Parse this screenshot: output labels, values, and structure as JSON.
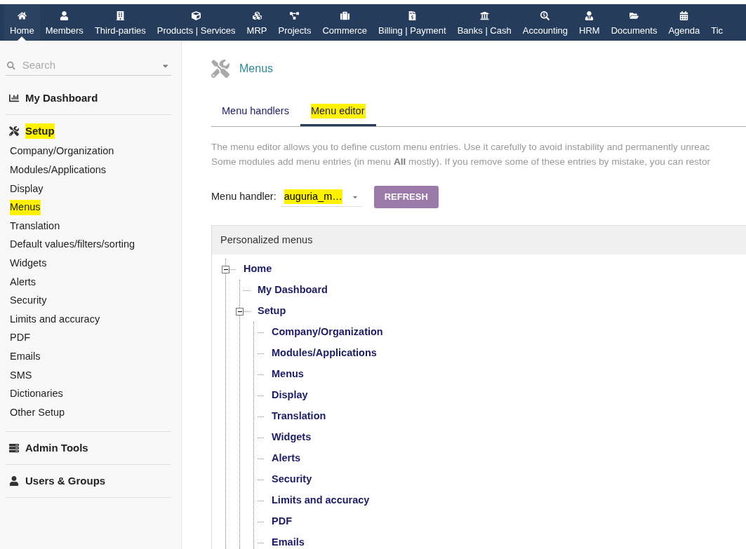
{
  "top_nav": [
    {
      "label": "Home",
      "selected": true
    },
    {
      "label": "Members",
      "selected": false
    },
    {
      "label": "Third-parties",
      "selected": false
    },
    {
      "label": "Products | Services",
      "selected": false
    },
    {
      "label": "MRP",
      "selected": false
    },
    {
      "label": "Projects",
      "selected": false
    },
    {
      "label": "Commerce",
      "selected": false
    },
    {
      "label": "Billing | Payment",
      "selected": false
    },
    {
      "label": "Banks | Cash",
      "selected": false
    },
    {
      "label": "Accounting",
      "selected": false
    },
    {
      "label": "HRM",
      "selected": false
    },
    {
      "label": "Documents",
      "selected": false
    },
    {
      "label": "Agenda",
      "selected": false
    },
    {
      "label": "Tic",
      "selected": false
    }
  ],
  "sidebar": {
    "search": {
      "placeholder": "Search"
    },
    "sections": [
      {
        "kind": "dashboard",
        "title": "My Dashboard",
        "highlighted": false
      },
      {
        "kind": "setup",
        "title": "Setup",
        "highlighted": true,
        "items": [
          {
            "label": "Company/Organization",
            "highlighted": false
          },
          {
            "label": "Modules/Applications",
            "highlighted": false
          },
          {
            "label": "Display",
            "highlighted": false
          },
          {
            "label": "Menus",
            "highlighted": true
          },
          {
            "label": "Translation",
            "highlighted": false
          },
          {
            "label": "Default values/filters/sorting",
            "highlighted": false
          },
          {
            "label": "Widgets",
            "highlighted": false
          },
          {
            "label": "Alerts",
            "highlighted": false
          },
          {
            "label": "Security",
            "highlighted": false
          },
          {
            "label": "Limits and accuracy",
            "highlighted": false
          },
          {
            "label": "PDF",
            "highlighted": false
          },
          {
            "label": "Emails",
            "highlighted": false
          },
          {
            "label": "SMS",
            "highlighted": false
          },
          {
            "label": "Dictionaries",
            "highlighted": false
          },
          {
            "label": "Other Setup",
            "highlighted": false
          }
        ]
      },
      {
        "kind": "admin",
        "title": "Admin Tools",
        "highlighted": false
      },
      {
        "kind": "users",
        "title": "Users & Groups",
        "highlighted": false
      }
    ]
  },
  "page": {
    "title": "Menus",
    "tabs": [
      {
        "label": "Menu handlers",
        "selected": false,
        "highlighted": false
      },
      {
        "label": "Menu editor",
        "selected": true,
        "highlighted": true
      }
    ],
    "description": [
      "The menu editor allows you to define custom menu entries. Use it carefully to avoid instability and permanently unreac",
      "Some modules add menu entries (in menu **All** mostly). If you remove some of these entries by mistake, you can restor"
    ],
    "handler": {
      "label": "Menu handler:",
      "value": "auguria_m…",
      "highlighted": true
    },
    "refresh_button": "REFRESH",
    "tree": {
      "title": "Personalized menus",
      "nodes": [
        {
          "label": "Home",
          "expanded": true,
          "children": [
            {
              "label": "My Dashboard"
            },
            {
              "label": "Setup",
              "expanded": true,
              "children": [
                {
                  "label": "Company/Organization"
                },
                {
                  "label": "Modules/Applications"
                },
                {
                  "label": "Menus"
                },
                {
                  "label": "Display"
                },
                {
                  "label": "Translation"
                },
                {
                  "label": "Widgets"
                },
                {
                  "label": "Alerts"
                },
                {
                  "label": "Security"
                },
                {
                  "label": "Limits and accuracy"
                },
                {
                  "label": "PDF"
                },
                {
                  "label": "Emails"
                }
              ]
            }
          ]
        }
      ]
    }
  }
}
